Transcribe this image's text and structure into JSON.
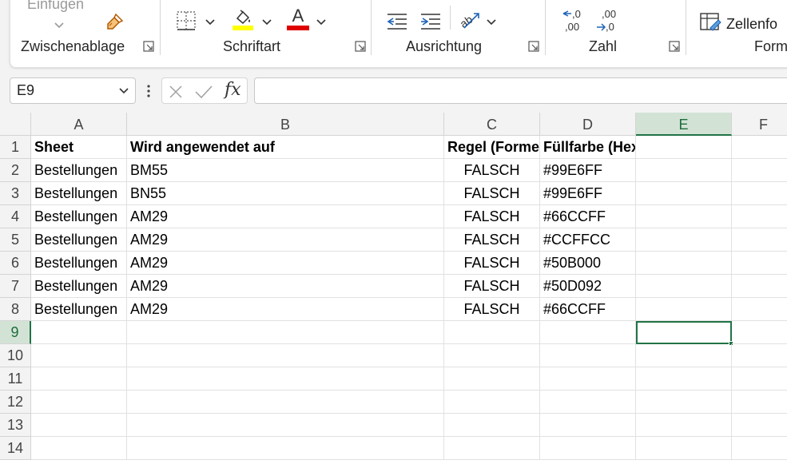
{
  "ribbon": {
    "paste_label": "Einfügen",
    "groups": {
      "clipboard": "Zwischenablage",
      "font": "Schriftart",
      "alignment": "Ausrichtung",
      "number": "Zahl",
      "styles": "Form"
    },
    "cell_format_label": "Zellenfo",
    "fill_color_bar": "#ffff00",
    "font_color_bar": "#e00000",
    "number_increase_decimal": [
      ",0",
      ",00"
    ],
    "number_decrease_decimal": [
      ",00",
      ",0"
    ]
  },
  "formula_bar": {
    "name_box": "E9",
    "formula": "",
    "fx_label": "fx"
  },
  "sheet": {
    "columns": [
      "A",
      "B",
      "C",
      "D",
      "E",
      "F"
    ],
    "selected_column": "E",
    "rows": [
      "1",
      "2",
      "3",
      "4",
      "5",
      "6",
      "7",
      "8",
      "9",
      "10",
      "11",
      "12",
      "13",
      "14"
    ],
    "selected_row": "9",
    "header_row": [
      "Sheet",
      "Wird angewendet auf",
      "Regel (Forme",
      "Füllfarbe (Hex)"
    ],
    "data": [
      [
        "Bestellungen",
        "BM55",
        "FALSCH",
        "#99E6FF"
      ],
      [
        "Bestellungen",
        "BN55",
        "FALSCH",
        "#99E6FF"
      ],
      [
        "Bestellungen",
        "AM29",
        "FALSCH",
        "#66CCFF"
      ],
      [
        "Bestellungen",
        "AM29",
        "FALSCH",
        "#CCFFCC"
      ],
      [
        "Bestellungen",
        "AM29",
        "FALSCH",
        "#50B000"
      ],
      [
        "Bestellungen",
        "AM29",
        "FALSCH",
        "#50D092"
      ],
      [
        "Bestellungen",
        "AM29",
        "FALSCH",
        "#66CCFF"
      ]
    ],
    "accent_color": "#217346"
  }
}
